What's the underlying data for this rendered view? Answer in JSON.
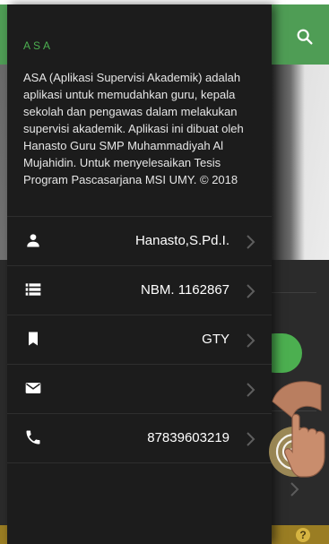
{
  "background_app": {
    "search_icon": "search-icon",
    "help_icon_glyph": "?"
  },
  "drawer": {
    "app_name": "ASA",
    "description": "ASA (Aplikasi Supervisi Akademik) adalah aplikasi untuk memudahkan guru, kepala sekolah dan pengawas dalam melakukan supervisi akademik. Aplikasi ini dibuat oleh Hanasto Guru SMP Muhammadiyah Al Mujahidin. Untuk menyelesaikan Tesis Program Pascasarjana MSI UMY. © 2018",
    "items": [
      {
        "icon": "person-icon",
        "value": "Hanasto,S.Pd.I."
      },
      {
        "icon": "list-icon",
        "value": "NBM. 1162867"
      },
      {
        "icon": "bookmark-icon",
        "value": "GTY"
      },
      {
        "icon": "email-icon",
        "value": ""
      },
      {
        "icon": "phone-icon",
        "value": "87839603219"
      }
    ]
  },
  "colors": {
    "accent_green": "#4caf50",
    "drawer_bg": "#1c1c1c",
    "topbar_green": "#4f9d55",
    "bottom_bar": "#9a7d23"
  }
}
